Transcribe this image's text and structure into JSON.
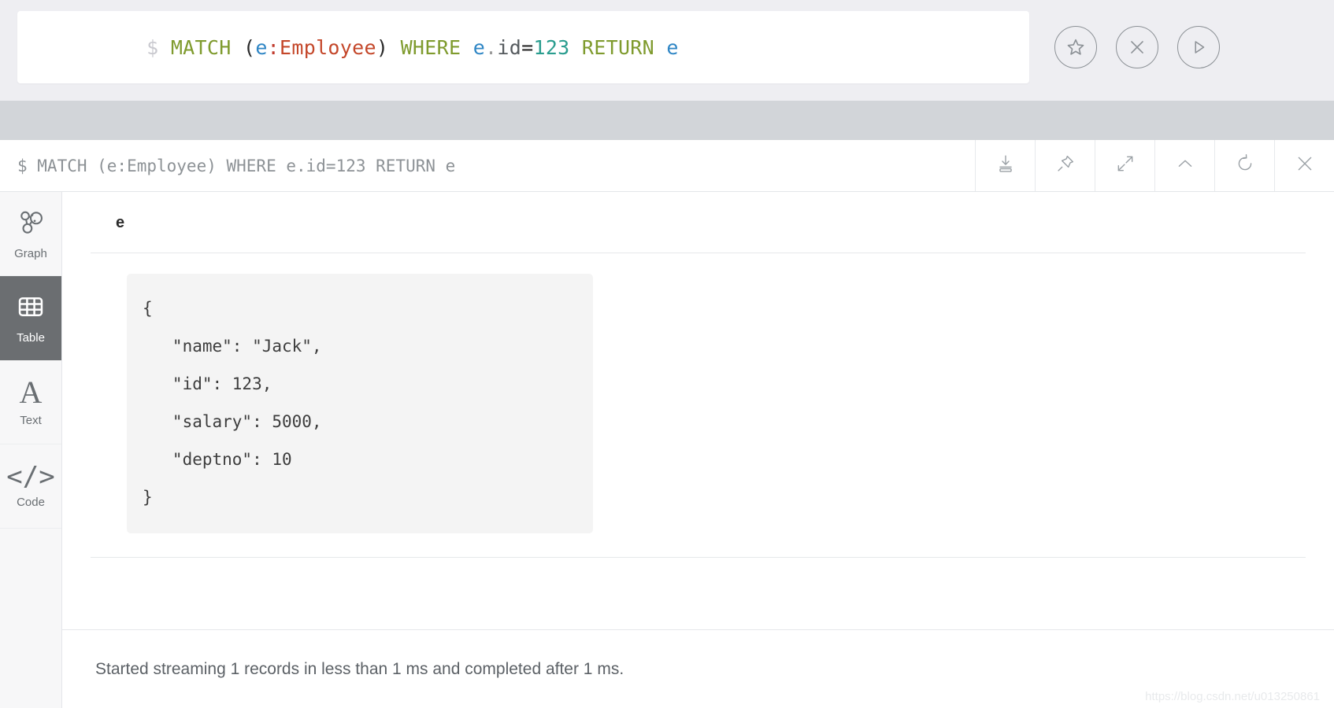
{
  "editor": {
    "prompt": "$",
    "query_tokens": [
      {
        "text": "MATCH",
        "type": "keyword"
      },
      {
        "text": " ",
        "type": "plain"
      },
      {
        "text": "(",
        "type": "paren"
      },
      {
        "text": "e",
        "type": "var"
      },
      {
        "text": ":",
        "type": "colon"
      },
      {
        "text": "Employee",
        "type": "label"
      },
      {
        "text": ")",
        "type": "paren"
      },
      {
        "text": " ",
        "type": "plain"
      },
      {
        "text": "WHERE",
        "type": "keyword"
      },
      {
        "text": " ",
        "type": "plain"
      },
      {
        "text": "e",
        "type": "var"
      },
      {
        "text": ".",
        "type": "dot"
      },
      {
        "text": "id",
        "type": "prop"
      },
      {
        "text": "=",
        "type": "op"
      },
      {
        "text": "123",
        "type": "number"
      },
      {
        "text": " ",
        "type": "plain"
      },
      {
        "text": "RETURN",
        "type": "keyword"
      },
      {
        "text": " ",
        "type": "plain"
      },
      {
        "text": "e",
        "type": "var"
      }
    ],
    "query_plain": "MATCH (e:Employee) WHERE e.id=123 RETURN e",
    "actions": [
      {
        "name": "favorite-button",
        "icon": "star-icon",
        "title": "Favorite"
      },
      {
        "name": "clear-button",
        "icon": "close-icon",
        "title": "Clear"
      },
      {
        "name": "run-button",
        "icon": "play-icon",
        "title": "Run"
      }
    ],
    "colors": {
      "prompt": "#c9c9cf",
      "keyword": "#7f9b2e",
      "variable": "#2f86c5",
      "label": "#c4472a",
      "number": "#2a9d8f",
      "property": "#555a5e",
      "background": "#eeeef2",
      "card": "#ffffff"
    }
  },
  "result": {
    "header_query": "$ MATCH (e:Employee) WHERE e.id=123 RETURN e",
    "tools": [
      {
        "name": "download-button",
        "icon": "download-icon",
        "title": "Download"
      },
      {
        "name": "pin-button",
        "icon": "pin-icon",
        "title": "Pin"
      },
      {
        "name": "fullscreen-button",
        "icon": "expand-icon",
        "title": "Fullscreen"
      },
      {
        "name": "collapse-button",
        "icon": "chevron-up-icon",
        "title": "Collapse"
      },
      {
        "name": "rerun-button",
        "icon": "refresh-icon",
        "title": "Rerun"
      },
      {
        "name": "close-button",
        "icon": "close-icon",
        "title": "Close"
      }
    ],
    "sidebar": [
      {
        "name": "sidebar-item-graph",
        "label": "Graph",
        "icon": "graph-icon",
        "active": false
      },
      {
        "name": "sidebar-item-table",
        "label": "Table",
        "icon": "table-icon",
        "active": true
      },
      {
        "name": "sidebar-item-text",
        "label": "Text",
        "icon": "text-icon",
        "active": false
      },
      {
        "name": "sidebar-item-code",
        "label": "Code",
        "icon": "code-icon",
        "active": false
      }
    ],
    "table": {
      "column_header": "e",
      "rows": [
        {
          "json_lines": [
            "{",
            "   \"name\": \"Jack\",",
            "   \"id\": 123,",
            "   \"salary\": 5000,",
            "   \"deptno\": 10",
            "}"
          ]
        }
      ]
    },
    "status": "Started streaming 1 records in less than 1 ms and completed after 1 ms."
  },
  "watermark": "https://blog.csdn.net/u013250861"
}
